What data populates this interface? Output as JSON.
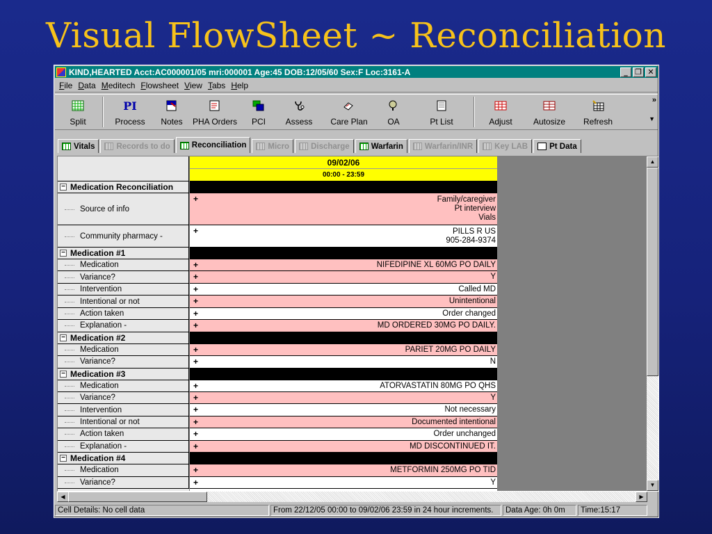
{
  "slide_title": "Visual FlowSheet ~ Reconciliation",
  "window": {
    "title": "KIND,HEARTED Acct:AC000001/05 mri:000001 Age:45 DOB:12/05/60 Sex:F Loc:3161-A",
    "minimize": "_",
    "restore": "❐",
    "close": "✕"
  },
  "menu": [
    "File",
    "Data",
    "Meditech",
    "Flowsheet",
    "View",
    "Tabs",
    "Help"
  ],
  "toolbar": [
    {
      "label": "Split",
      "icon": "split-grid-icon"
    },
    {
      "label": "Process",
      "icon": "pi-process-icon",
      "glyph": "PI"
    },
    {
      "label": "Notes",
      "icon": "notes-icon"
    },
    {
      "label": "PHA Orders",
      "icon": "pha-orders-icon"
    },
    {
      "label": "PCI",
      "icon": "pci-icon"
    },
    {
      "label": "Assess",
      "icon": "stethoscope-icon"
    },
    {
      "label": "Care Plan",
      "icon": "care-plan-icon"
    },
    {
      "label": "OA",
      "icon": "oa-icon"
    },
    {
      "label": "Pt List",
      "icon": "pt-list-icon"
    },
    {
      "label": "Adjust",
      "icon": "adjust-icon"
    },
    {
      "label": "Autosize",
      "icon": "autosize-icon"
    },
    {
      "label": "Refresh",
      "icon": "refresh-icon"
    }
  ],
  "toolbar_more": "»",
  "tabs": [
    {
      "label": "Vitals",
      "state": "normal"
    },
    {
      "label": "Records to do",
      "state": "disabled"
    },
    {
      "label": "Reconciliation",
      "state": "active"
    },
    {
      "label": "Micro",
      "state": "disabled"
    },
    {
      "label": "Discharge",
      "state": "disabled"
    },
    {
      "label": "Warfarin",
      "state": "normal"
    },
    {
      "label": "Warfarin/INR",
      "state": "disabled"
    },
    {
      "label": "Key LAB",
      "state": "disabled"
    },
    {
      "label": "Pt Data",
      "state": "normal"
    }
  ],
  "grid": {
    "date": "09/02/06",
    "time_range": "00:00 - 23:59",
    "rows": [
      {
        "type": "group",
        "label": "Medication Reconciliation"
      },
      {
        "type": "item",
        "label": "Source of info",
        "value": "Family/caregiver\nPt interview\nVials",
        "color": "pink",
        "h": 46
      },
      {
        "type": "item",
        "label": "Community pharmacy -",
        "value": "PILLS R US\n905-284-9374",
        "color": "white",
        "h": 32
      },
      {
        "type": "group",
        "label": "Medication #1"
      },
      {
        "type": "item",
        "label": "Medication",
        "value": "NIFEDIPINE XL 60MG PO DAILY",
        "color": "pink"
      },
      {
        "type": "item",
        "label": "Variance?",
        "value": "Y",
        "color": "pink"
      },
      {
        "type": "item",
        "label": "Intervention",
        "value": "Called MD",
        "color": "white"
      },
      {
        "type": "item",
        "label": "Intentional or not",
        "value": "Unintentional",
        "color": "pink"
      },
      {
        "type": "item",
        "label": "Action taken",
        "value": "Order changed",
        "color": "white"
      },
      {
        "type": "item",
        "label": "Explanation -",
        "value": "MD ORDERED 30MG PO DAILY.",
        "color": "pink"
      },
      {
        "type": "group",
        "label": "Medication #2"
      },
      {
        "type": "item",
        "label": "Medication",
        "value": "PARIET 20MG PO DAILY",
        "color": "pink"
      },
      {
        "type": "item",
        "label": "Variance?",
        "value": "N",
        "color": "white"
      },
      {
        "type": "group",
        "label": "Medication #3"
      },
      {
        "type": "item",
        "label": "Medication",
        "value": "ATORVASTATIN 80MG PO QHS",
        "color": "white"
      },
      {
        "type": "item",
        "label": "Variance?",
        "value": "Y",
        "color": "pink"
      },
      {
        "type": "item",
        "label": "Intervention",
        "value": "Not necessary",
        "color": "white"
      },
      {
        "type": "item",
        "label": "Intentional or not",
        "value": "Documented intentional",
        "color": "pink"
      },
      {
        "type": "item",
        "label": "Action taken",
        "value": "Order unchanged",
        "color": "white"
      },
      {
        "type": "item",
        "label": "Explanation -",
        "value": "MD DISCONTINUED IT.",
        "color": "pink"
      },
      {
        "type": "group",
        "label": "Medication #4"
      },
      {
        "type": "item",
        "label": "Medication",
        "value": "METFORMIN 250MG PO TID",
        "color": "pink"
      },
      {
        "type": "item",
        "label": "Variance?",
        "value": "Y",
        "color": "white"
      }
    ]
  },
  "status": {
    "cell_details": "Cell Details: No cell data",
    "range": "From 22/12/05 00:00 to 09/02/06 23:59 in 24 hour increments.",
    "data_age": "Data Age: 0h 0m",
    "time": "Time:15:17"
  },
  "colors": {
    "slide_title": "#f7c21b",
    "titlebar": "#00807f",
    "date_header": "#ffff00",
    "pink_cell": "#ffc0c0"
  }
}
